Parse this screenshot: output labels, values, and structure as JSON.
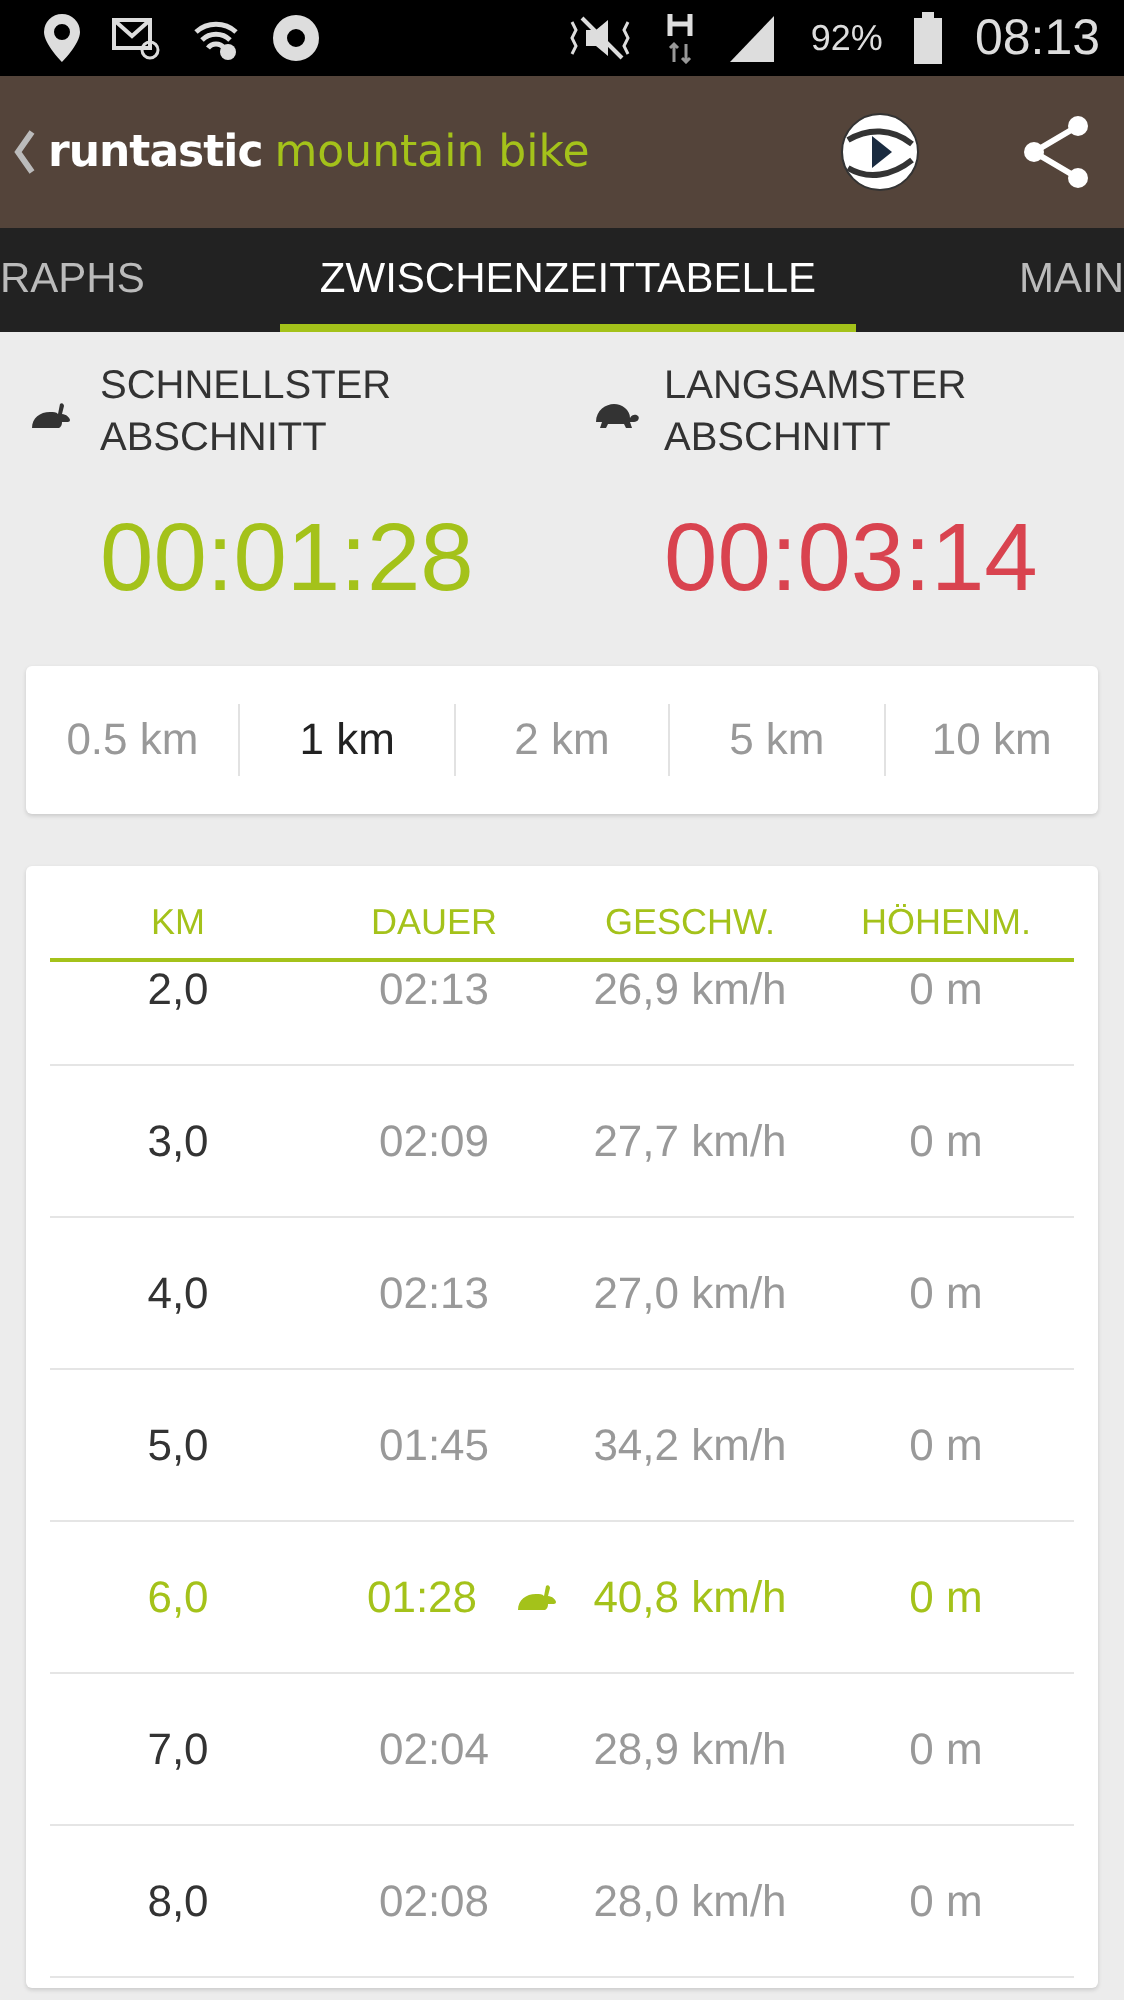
{
  "status_bar": {
    "battery": "92%",
    "time": "08:13"
  },
  "app_bar": {
    "brand": "runtastic",
    "product": "mountain bike"
  },
  "tabs": [
    {
      "label": "RAPHS",
      "selected": false
    },
    {
      "label": "ZWISCHENZEITTABELLE",
      "selected": true
    },
    {
      "label": "MAIN",
      "selected": false
    }
  ],
  "summary": [
    {
      "kind": "fastest",
      "label": "SCHNELLSTER ABSCHNITT",
      "time": "00:01:28"
    },
    {
      "kind": "slowest",
      "label": "LANGSAMSTER ABSCHNITT",
      "time": "00:03:14"
    }
  ],
  "distances": [
    {
      "label": "0.5 km",
      "selected": false
    },
    {
      "label": "1 km",
      "selected": true
    },
    {
      "label": "2 km",
      "selected": false
    },
    {
      "label": "5 km",
      "selected": false
    },
    {
      "label": "10 km",
      "selected": false
    }
  ],
  "table": {
    "columns": [
      "KM",
      "DAUER",
      "GESCHW.",
      "HÖHENM."
    ],
    "rows": [
      {
        "km": "2,0",
        "duration": "02:13",
        "speed": "26,9 km/h",
        "elevation": "0 m",
        "fastest": false
      },
      {
        "km": "3,0",
        "duration": "02:09",
        "speed": "27,7 km/h",
        "elevation": "0 m",
        "fastest": false
      },
      {
        "km": "4,0",
        "duration": "02:13",
        "speed": "27,0 km/h",
        "elevation": "0 m",
        "fastest": false
      },
      {
        "km": "5,0",
        "duration": "01:45",
        "speed": "34,2 km/h",
        "elevation": "0 m",
        "fastest": false
      },
      {
        "km": "6,0",
        "duration": "01:28",
        "speed": "40,8 km/h",
        "elevation": "0 m",
        "fastest": true
      },
      {
        "km": "7,0",
        "duration": "02:04",
        "speed": "28,9 km/h",
        "elevation": "0 m",
        "fastest": false
      },
      {
        "km": "8,0",
        "duration": "02:08",
        "speed": "28,0 km/h",
        "elevation": "0 m",
        "fastest": false
      }
    ]
  }
}
